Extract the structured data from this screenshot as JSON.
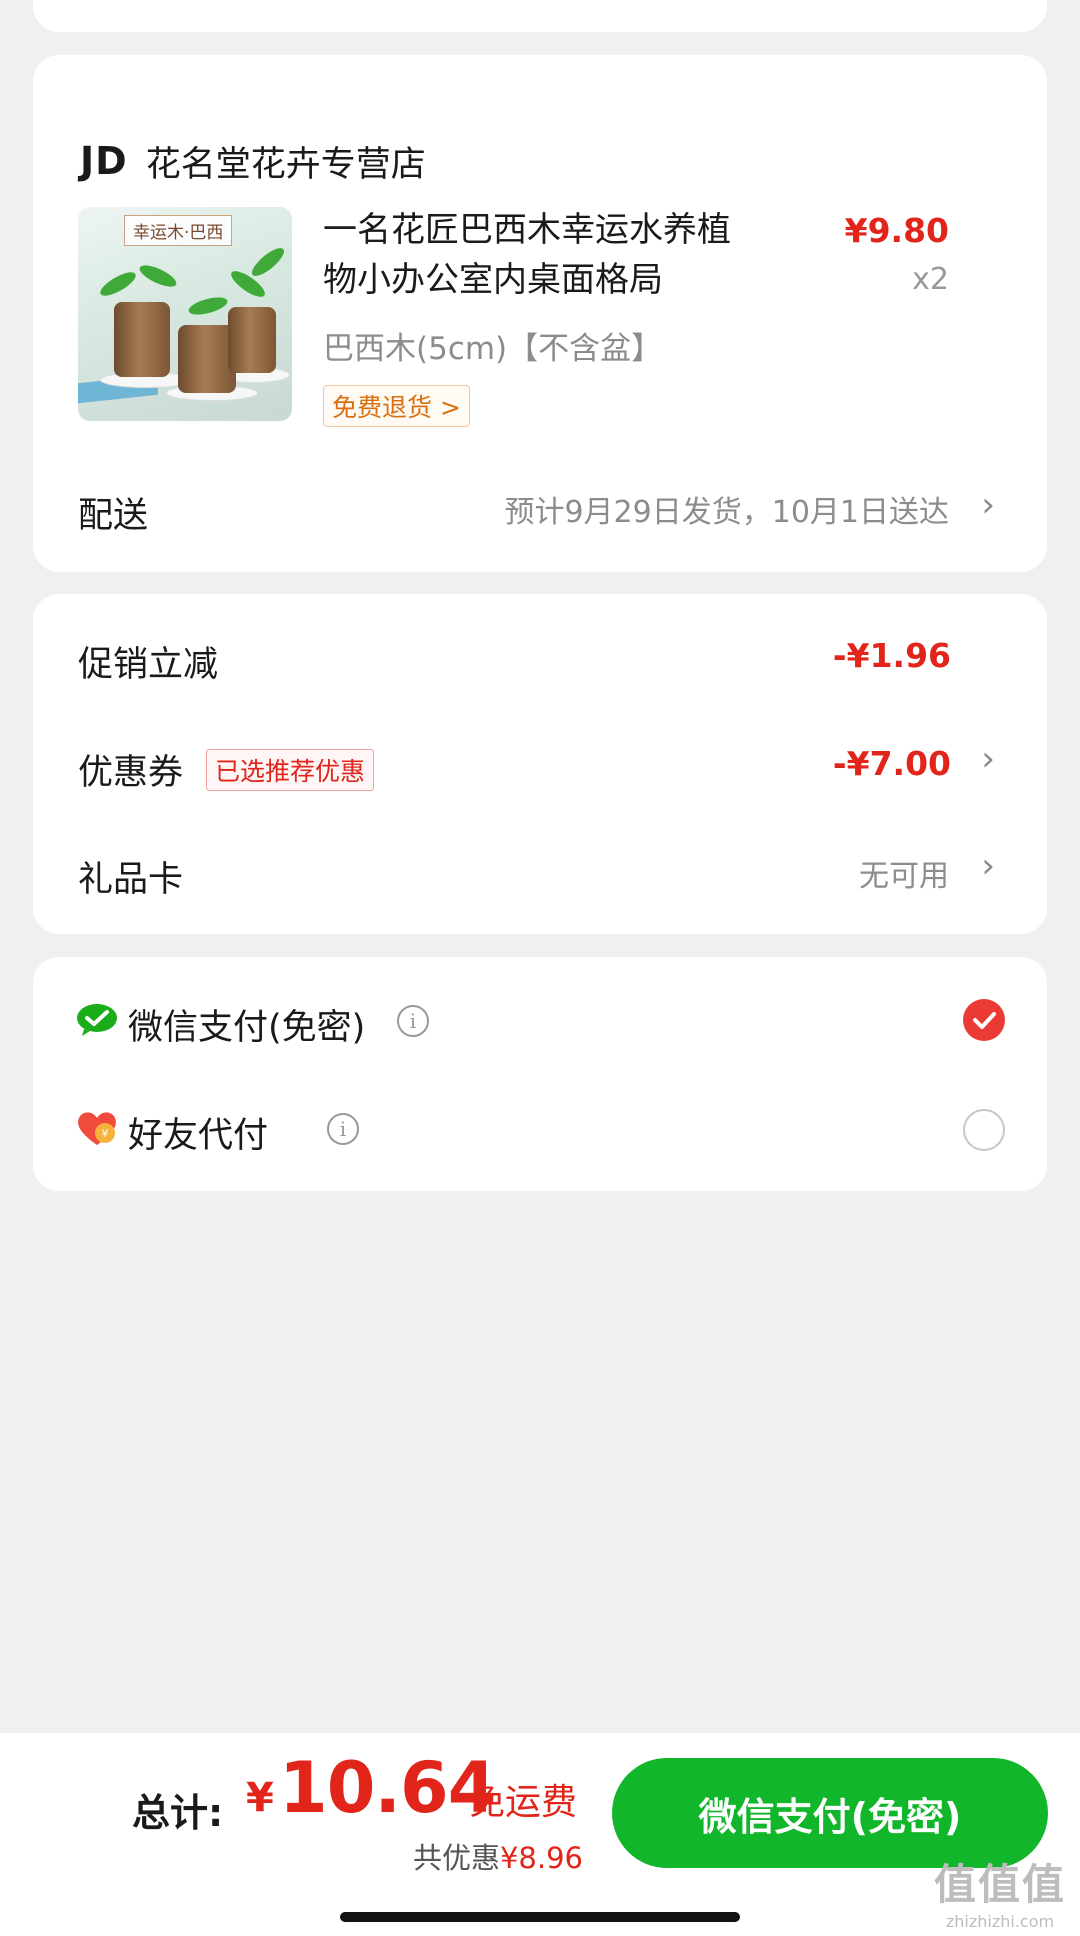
{
  "store": {
    "logo": "JD",
    "name": "花名堂花卉专营店"
  },
  "product": {
    "image_tag": "幸运木·巴西",
    "title": "一名花匠巴西木幸运水养植物小办公室内桌面格局",
    "price": "¥9.80",
    "quantity": "x2",
    "spec": "巴西木(5cm)【不含盆】",
    "return_badge": "免费退货 >"
  },
  "delivery": {
    "label": "配送",
    "estimate": "预计9月29日发货，10月1日送达"
  },
  "discounts": {
    "promo_label": "促销立减",
    "promo_value": "-¥1.96",
    "coupon_label": "优惠券",
    "coupon_tag": "已选推荐优惠",
    "coupon_value": "-¥7.00",
    "giftcard_label": "礼品卡",
    "giftcard_value": "无可用"
  },
  "payment_methods": [
    {
      "label": "微信支付(免密)",
      "icon": "wechat-pay-icon",
      "selected": true
    },
    {
      "label": "好友代付",
      "icon": "friend-pay-heart-icon",
      "selected": false
    }
  ],
  "footer": {
    "total_label": "总计:",
    "currency": "¥",
    "total_amount": "10.64",
    "free_shipping": "免运费",
    "savings_prefix": "共优惠",
    "savings_amount": "¥8.96",
    "pay_button": "微信支付(免密)"
  },
  "watermark": {
    "main": "值值值",
    "sub": "zhizhizhi.com"
  },
  "colors": {
    "accent_red": "#e1251b",
    "pay_green": "#12b62b",
    "background": "#f0f0f0"
  }
}
